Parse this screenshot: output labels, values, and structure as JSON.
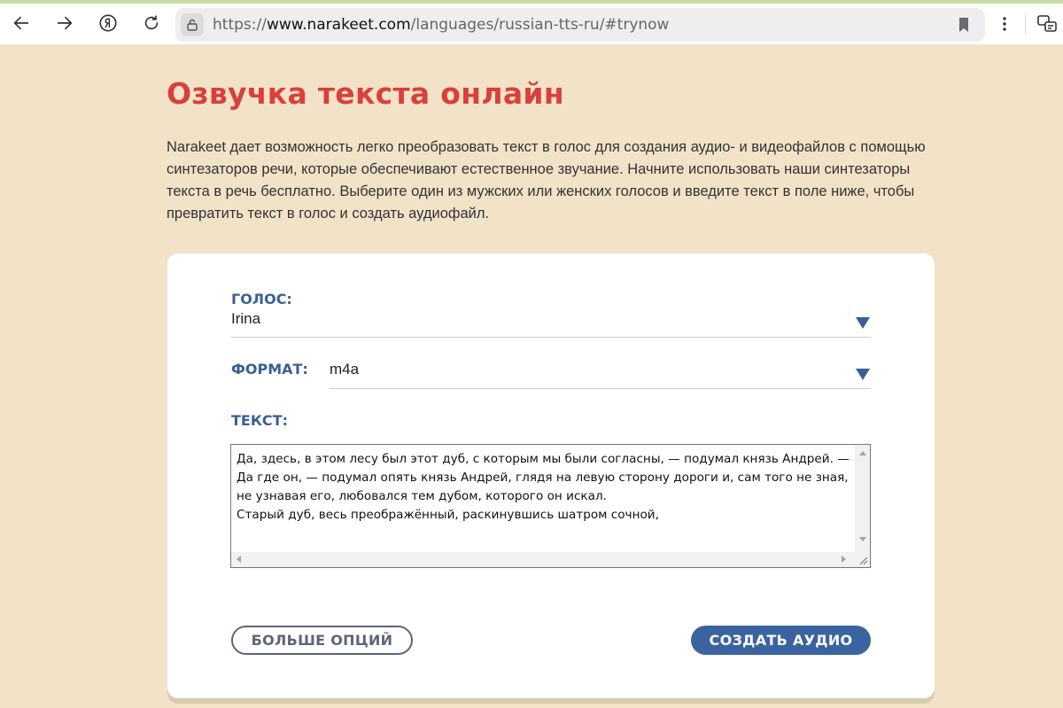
{
  "browser": {
    "url_prefix": "https://",
    "url_domain": "www.narakeet.com",
    "url_path": "/languages/russian-tts-ru/#trynow"
  },
  "page": {
    "title": "Озвучка текста онлайн",
    "intro": "Narakeet дает возможность легко преобразовать текст в голос для создания аудио- и видеофайлов с помощью синтезаторов речи, которые обеспечивают естественное звучание. Начните использовать наши синтезаторы текста в речь бесплатно. Выберите один из мужских или женских голосов и введите текст в поле ниже, чтобы превратить текст в голос и создать аудиофайл."
  },
  "form": {
    "voice_label": "ГОЛОС:",
    "voice_value": "Irina",
    "format_label": "ФОРМАТ:",
    "format_value": "m4a",
    "text_label": "ТЕКСТ:",
    "text_value": "Да, здесь, в этом лесу был этот дуб, с которым мы были согласны, — подумал князь Андрей. — Да где он, — подумал опять князь Андрей, глядя на левую сторону дороги и, сам того не зная, не узнавая его, любовался тем дубом, которого он искал.\nСтарый дуб, весь преображённый, раскинувшись шатром сочной,",
    "more_options_label": "БОЛЬШЕ ОПЦИЙ",
    "create_audio_label": "СОЗДАТЬ АУДИО"
  },
  "colors": {
    "page_background": "#f1e2c8",
    "title": "#d9403a",
    "label": "#3a5f95",
    "primary_button": "#3b63a0"
  },
  "icons": [
    "back-arrow-icon",
    "forward-arrow-icon",
    "yandex-icon",
    "reload-icon",
    "lock-icon",
    "bookmark-icon",
    "more-vertical-icon",
    "extension-icon",
    "dropdown-caret-icon"
  ]
}
